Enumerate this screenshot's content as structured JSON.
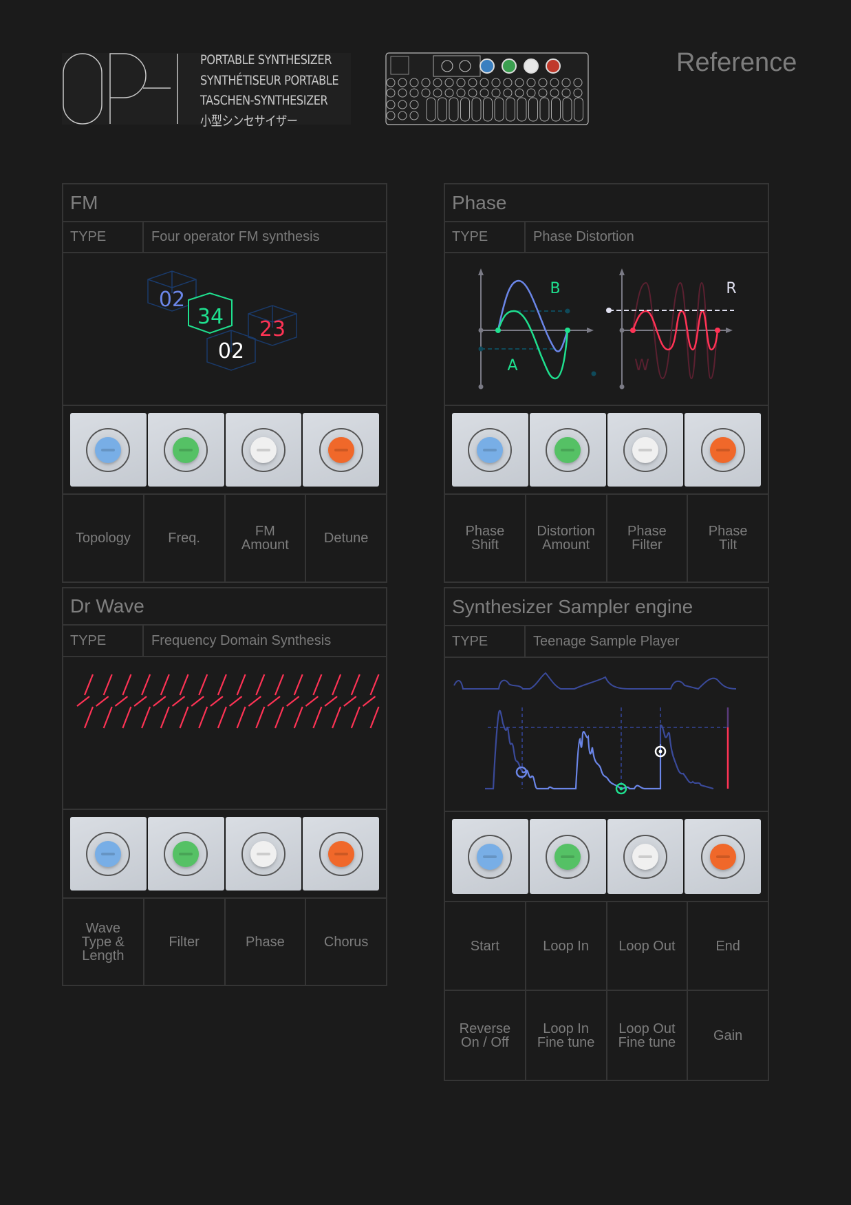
{
  "header": {
    "logo_text": "OP-",
    "tagline_lines": [
      "PORTABLE SYNTHESIZER",
      "SYNTHÉTISEUR PORTABLE",
      "TASCHEN-SYNTHESIZER",
      "小型シンセサイザー"
    ],
    "device_label": "OP-1 device illustration",
    "page_label": "Reference"
  },
  "colors": {
    "background": "#1b1b1b",
    "border": "#353535",
    "text": "#7d7d7d",
    "blue": "#6b86e8",
    "green": "#1fe08f",
    "red": "#ff3355",
    "navy": "#1a3a6a",
    "knob_blue": "#78aee6",
    "knob_green": "#55c165",
    "knob_white": "#f0f0f0",
    "knob_orange": "#f0682a"
  },
  "engines": [
    {
      "title": "FM",
      "type_key": "TYPE",
      "type_value": "Four operator FM synthesis",
      "diagram": {
        "operators": [
          "02",
          "34",
          "23",
          "02"
        ]
      },
      "knobs": [
        "blue",
        "green",
        "white",
        "orange"
      ],
      "params": [
        "Topology",
        "Freq.",
        "FM\nAmount",
        "Detune"
      ]
    },
    {
      "title": "Phase",
      "type_key": "TYPE",
      "type_value": "Phase Distortion",
      "diagram": {
        "labels": [
          "B",
          "A",
          "R",
          "W"
        ]
      },
      "knobs": [
        "blue",
        "green",
        "white",
        "orange"
      ],
      "params": [
        "Phase\nShift",
        "Distortion\nAmount",
        "Phase\nFilter",
        "Phase\nTilt"
      ]
    },
    {
      "title": "Dr Wave",
      "type_key": "TYPE",
      "type_value": "Frequency Domain Synthesis",
      "knobs": [
        "blue",
        "green",
        "white",
        "orange"
      ],
      "params": [
        "Wave\nType &\nLength",
        "Filter",
        "Phase",
        "Chorus"
      ]
    },
    {
      "title": "Synthesizer Sampler engine",
      "type_key": "TYPE",
      "type_value": "Teenage Sample Player",
      "knobs": [
        "blue",
        "green",
        "white",
        "orange"
      ],
      "params": [
        "Start",
        "Loop In",
        "Loop Out",
        "End"
      ],
      "params_row2": [
        "Reverse\nOn / Off",
        "Loop In\nFine tune",
        "Loop Out\nFine tune",
        "Gain"
      ]
    }
  ]
}
